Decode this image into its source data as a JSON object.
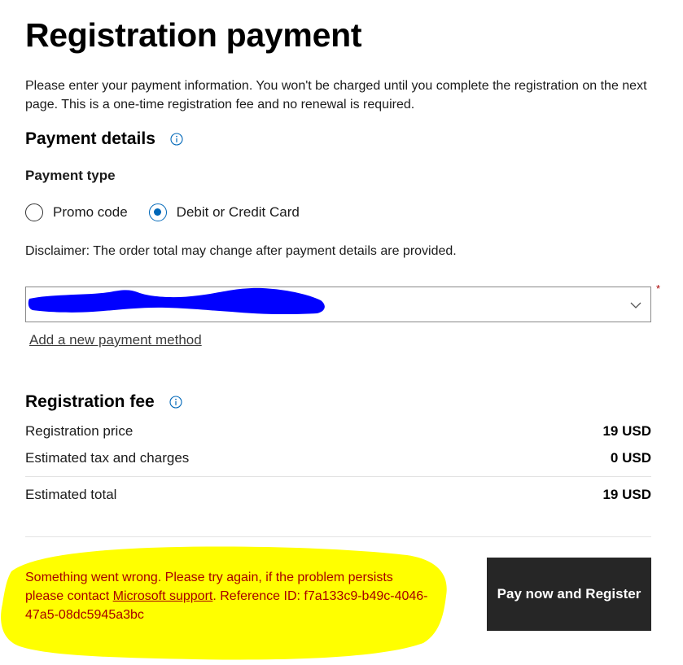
{
  "page": {
    "title": "Registration payment",
    "intro": "Please enter your payment information. You won't be charged until you complete the registration on the next page. This is a one-time registration fee and no renewal is required."
  },
  "payment_details": {
    "title": "Payment details",
    "info_icon": "info-icon",
    "payment_type_label": "Payment type",
    "options": [
      {
        "label": "Promo code",
        "selected": false
      },
      {
        "label": "Debit or Credit Card",
        "selected": true
      }
    ],
    "disclaimer": "Disclaimer: The order total may change after payment details are provided.",
    "payment_method_select": {
      "value": "",
      "redacted": true,
      "redaction_color": "#0000ff",
      "required_marker": "*"
    },
    "add_method_link": "Add a new payment method"
  },
  "registration_fee": {
    "title": "Registration fee",
    "info_icon": "info-icon",
    "rows": [
      {
        "label": "Registration price",
        "value": "19 USD"
      },
      {
        "label": "Estimated tax and charges",
        "value": "0 USD"
      }
    ],
    "total": {
      "label": "Estimated total",
      "value": "19 USD"
    }
  },
  "error": {
    "prefix": "Something went wrong. Please try again, if the problem persists please contact ",
    "link": "Microsoft support",
    "suffix": ". Reference ID: f7a133c9-b49c-4046-47a5-08dc5945a3bc",
    "highlight_color": "#ffff00",
    "text_color": "#a80000"
  },
  "actions": {
    "pay_button": "Pay now and Register"
  },
  "colors": {
    "accent": "#0067b8",
    "button_bg": "#262626",
    "error": "#a80000"
  }
}
